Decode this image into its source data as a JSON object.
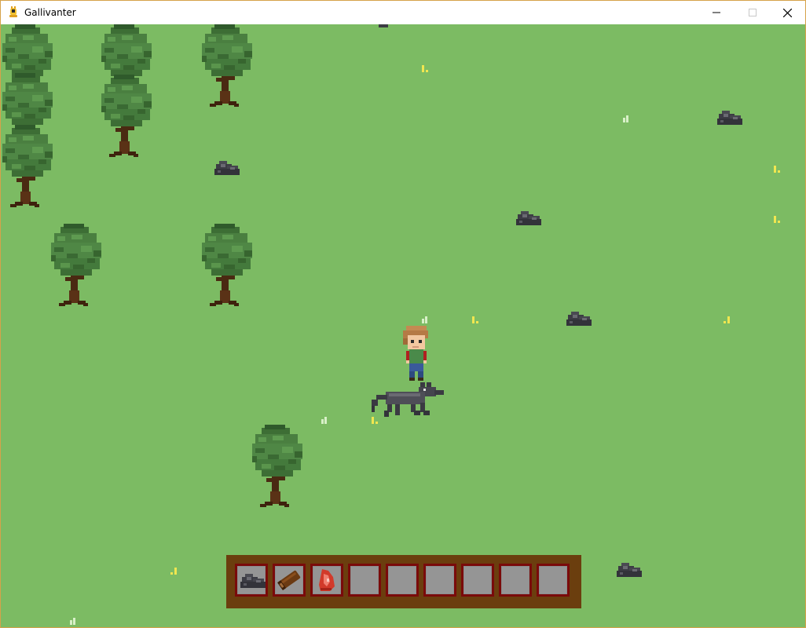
{
  "window": {
    "title": "Gallivanter",
    "controls": [
      "minimize",
      "maximize",
      "close"
    ],
    "border_color": "#d6a24a"
  },
  "world": {
    "grass_color": "#7cbb63",
    "trees": 9,
    "rocks": 6,
    "player": "player-character-icon",
    "companion": "wolf-icon"
  },
  "hotbar": {
    "slot_count": 9,
    "slots": [
      {
        "item": "stone-icon"
      },
      {
        "item": "wood-log-icon"
      },
      {
        "item": "raw-meat-icon"
      },
      {
        "item": ""
      },
      {
        "item": ""
      },
      {
        "item": ""
      },
      {
        "item": ""
      },
      {
        "item": ""
      },
      {
        "item": ""
      }
    ],
    "frame_color": "#6b3e0e",
    "slot_border_color": "#7a0a0a",
    "slot_fill_color": "#959595"
  }
}
